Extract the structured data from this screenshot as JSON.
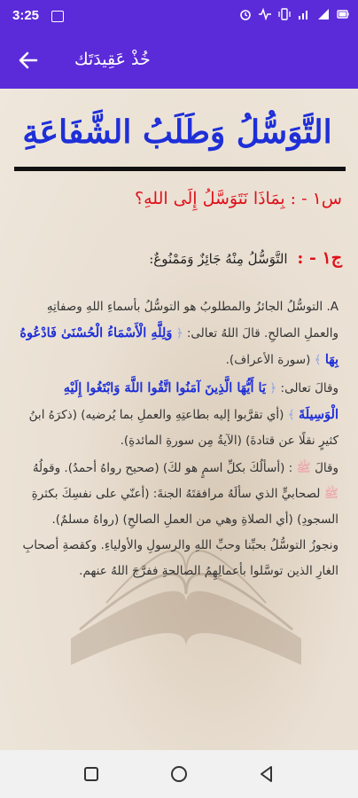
{
  "status_bar": {
    "time": "3:25",
    "icons": [
      "gallery-icon",
      "alarm-icon",
      "activity-icon",
      "vibrate-icon",
      "signal-icon",
      "signal-icon",
      "battery-icon"
    ]
  },
  "app_bar": {
    "title": "خُذْ عَقِيدَتَك",
    "back_icon": "arrow-left-icon"
  },
  "content": {
    "title": "التَّوَسُّلُ وَطَلَبُ الشَّفَاعَةِ",
    "question": {
      "label": "س١ - :",
      "text": "بِمَاذَا نَتَوَسَّلُ إِلَى اللهِ؟"
    },
    "answer": {
      "label": "ج١ - :",
      "text": "التَّوَسُّلُ مِنْهُ جَائِزٌ وَمَمْنُوعٌ:"
    },
    "paragraphs": [
      {
        "part1": "A. التوسُّلُ الجائزُ والمطلوبُ هو التوسُّلُ بأسماءِ اللهِ وصفاتِهِ والعملِ الصالحِ. قالَ اللهُ تعالى:",
        "verse": "وَلِلَّهِ الْأَسْمَاءُ الْحُسْنَىٰ فَادْعُوهُ بِهَا",
        "part2": "(سورة الأعراف)."
      },
      {
        "part1": "وقالَ تعالى:",
        "verse": "يَا أَيُّهَا الَّذِينَ آمَنُوا اتَّقُوا اللَّهَ وَابْتَغُوا إِلَيْهِ الْوَسِيلَةَ",
        "part2": "(أي تقرَّبوا إليه بطاعتِهِ والعملِ بما يُرضيه) (ذكرَهُ ابنُ كثيرٍ نقلًا عن قتادةَ) (الآيةُ مِن سورةِ المائدةِ)."
      },
      {
        "part1": "وقالَ",
        "honor1": "ﷺ",
        "part2": ": (أسألُكَ بكلِّ اسمٍ هو لكَ) (صحيح رواهُ أحمدُ). وقولُهُ",
        "honor2": "ﷺ",
        "part3": "لصحابيٍّ الذي سألَهُ مرافقتَهُ الجنةَ: (أعنّي على نفسِكَ بكثرةِ السجودِ) (أي الصلاةِ وهي من العملِ الصالحِ) (رواهُ مسلمٌ). ونجوزُ التوسُّلُ بحبِّنا وحبِّ اللهِ والرسولِ والأولياءِ. وكقصةِ أصحابِ الغارِ الذين توسَّلوا بأعمالِهِمُ الصالحةِ ففرَّجَ اللهُ عنهم."
      }
    ]
  },
  "nav_bar": {
    "buttons": [
      "recent-apps",
      "home",
      "back"
    ]
  },
  "colors": {
    "primary": "#5b2bd9",
    "title_blue": "#1e2fd8",
    "question_red": "#e0101a"
  }
}
